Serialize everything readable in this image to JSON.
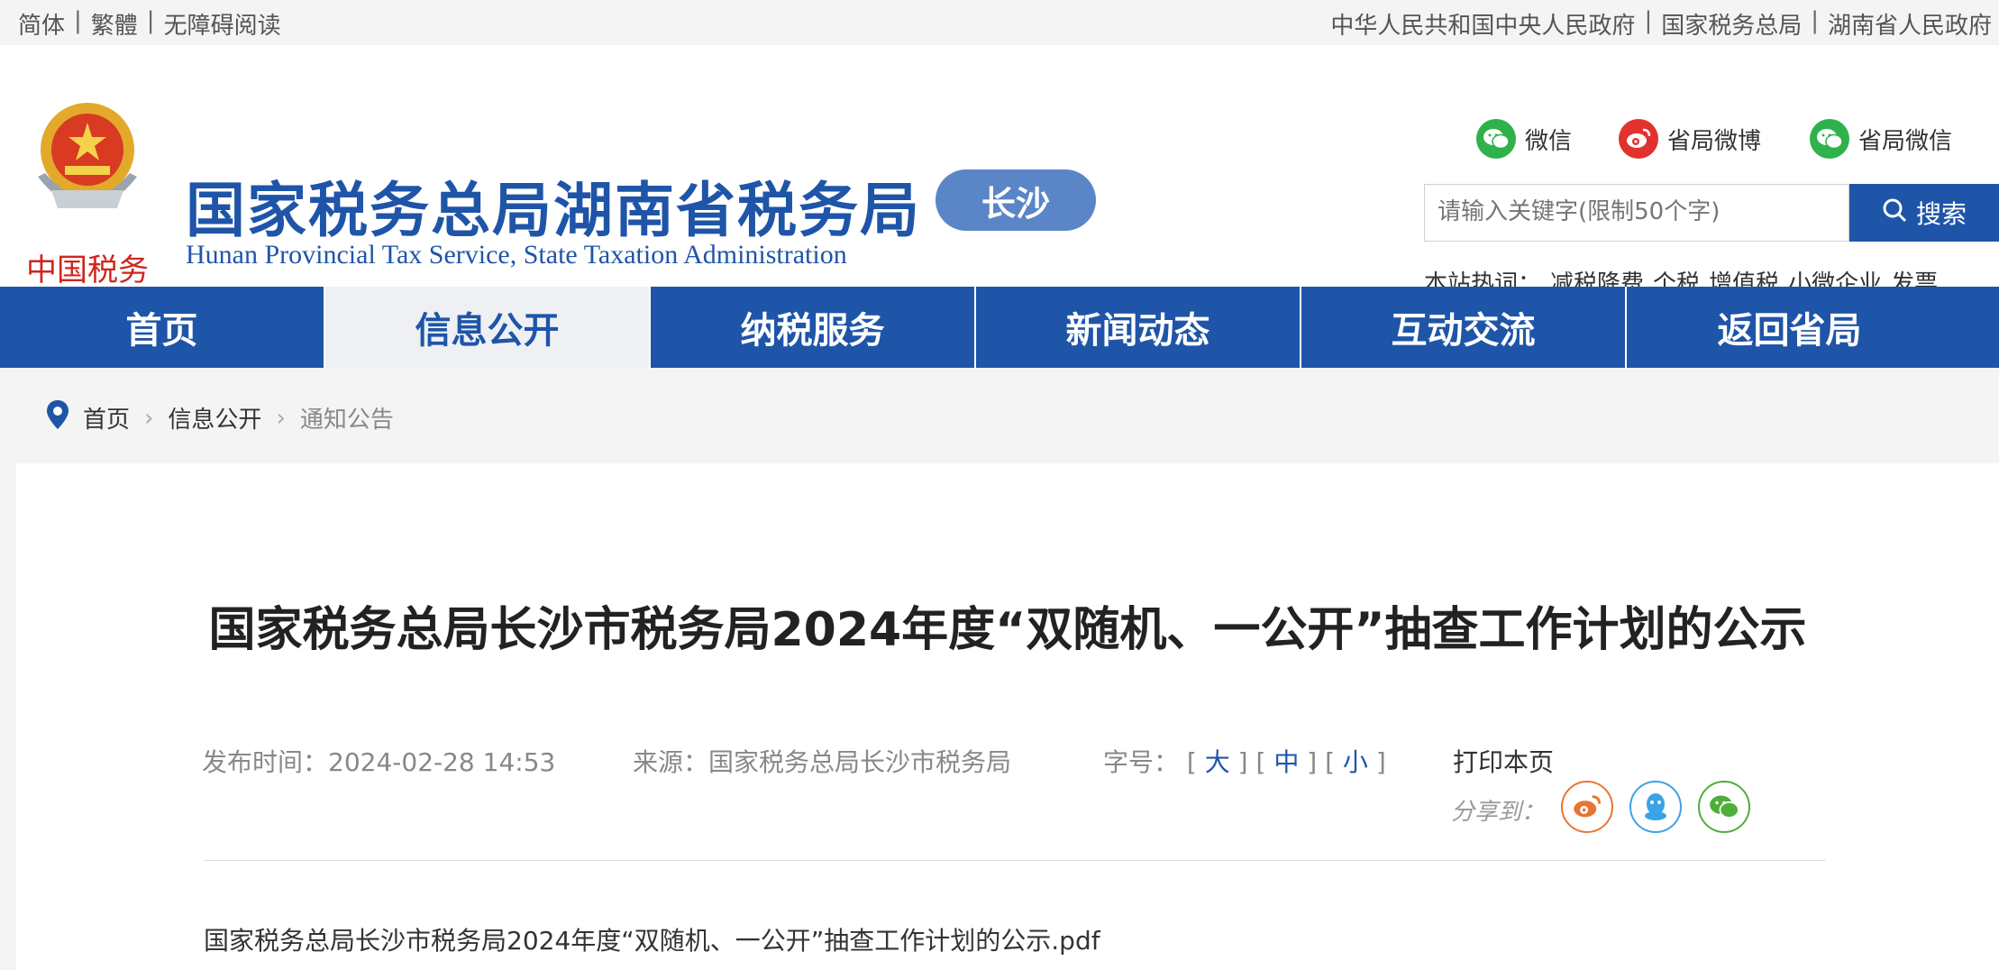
{
  "topbar": {
    "simplified": "简体",
    "traditional": "繁體",
    "accessible": "无障碍阅读",
    "gov_link": "中华人民共和国中央人民政府",
    "sat_link": "国家税务总局",
    "hunan_link": "湖南省人民政府"
  },
  "header": {
    "title": "国家税务总局湖南省税务局",
    "city": "长沙",
    "subtitle": "Hunan Provincial  Tax Service,  State Taxation Administration",
    "emblem_text": "中国税务",
    "social": {
      "wechat": "微信",
      "weibo": "省局微博",
      "wechat2": "省局微信"
    },
    "search": {
      "placeholder": "请输入关键字(限制50个字)",
      "button": "搜索"
    },
    "hot": {
      "label": "本站热词：",
      "items": [
        "减税降费",
        "个税",
        "增值税",
        "小微企业",
        "发票"
      ]
    }
  },
  "nav": {
    "items": [
      {
        "label": "首页"
      },
      {
        "label": "信息公开"
      },
      {
        "label": "纳税服务"
      },
      {
        "label": "新闻动态"
      },
      {
        "label": "互动交流"
      },
      {
        "label": "返回省局"
      }
    ]
  },
  "breadcrumb": {
    "home": "首页",
    "level1": "信息公开",
    "current": "通知公告"
  },
  "article": {
    "title": "国家税务总局长沙市税务局2024年度“双随机、一公开”抽查工作计划的公示",
    "publish_label": "发布时间：",
    "publish_time": "2024-02-28 14:53",
    "source_label": "来源：",
    "source": "国家税务总局长沙市税务局",
    "font_label": "字号：",
    "font_large": "大",
    "font_medium": "中",
    "font_small": "小",
    "print": "打印本页",
    "share_label": "分享到：",
    "attachment": "国家税务总局长沙市税务局2024年度“双随机、一公开”抽查工作计划的公示.pdf"
  },
  "colors": {
    "brand_blue": "#1f55a8",
    "badge_blue": "#5a86c7",
    "wechat_green": "#2fb24a",
    "weibo_red": "#e2322e"
  }
}
